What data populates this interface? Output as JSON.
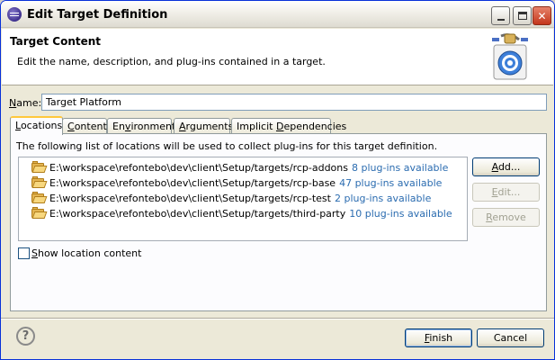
{
  "window": {
    "title": "Edit Target Definition"
  },
  "banner": {
    "title": "Target Content",
    "description": "Edit the name, description, and plug-ins contained in a target."
  },
  "name_field": {
    "label_mnemonic": "N",
    "label_rest": "ame:",
    "value": "Target Platform"
  },
  "tabs": [
    {
      "mnemonic": "L",
      "rest": "ocations",
      "active": true
    },
    {
      "pre": "",
      "mnemonic": "C",
      "rest": "ontent"
    },
    {
      "pre": "En",
      "mnemonic": "v",
      "rest": "ironment"
    },
    {
      "pre": "",
      "mnemonic": "A",
      "rest": "rguments"
    },
    {
      "pre": "Implicit ",
      "mnemonic": "D",
      "rest": "ependencies"
    }
  ],
  "locations_panel": {
    "description": "The following list of locations will be used to collect plug-ins for this target definition.",
    "locations": [
      {
        "path": "E:\\workspace\\refontebo\\dev\\client\\Setup/targets/rcp-addons",
        "count": "8 plug-ins available"
      },
      {
        "path": "E:\\workspace\\refontebo\\dev\\client\\Setup/targets/rcp-base",
        "count": "47 plug-ins available"
      },
      {
        "path": "E:\\workspace\\refontebo\\dev\\client\\Setup/targets/rcp-test",
        "count": "2 plug-ins available"
      },
      {
        "path": "E:\\workspace\\refontebo\\dev\\client\\Setup/targets/third-party",
        "count": "10 plug-ins available"
      }
    ],
    "add_button": {
      "mnemonic": "A",
      "rest": "dd..."
    },
    "edit_button": {
      "mnemonic": "E",
      "rest": "dit..."
    },
    "remove_button": {
      "mnemonic": "R",
      "rest": "emove"
    },
    "show_content": {
      "mnemonic": "S",
      "rest": "how location content",
      "checked": false
    }
  },
  "footer": {
    "help": "?",
    "finish": {
      "mnemonic": "F",
      "rest": "inish"
    },
    "cancel": "Cancel"
  },
  "colors": {
    "count_link": "#2b6cb0",
    "active_tab_highlight": "#ffc83c"
  }
}
